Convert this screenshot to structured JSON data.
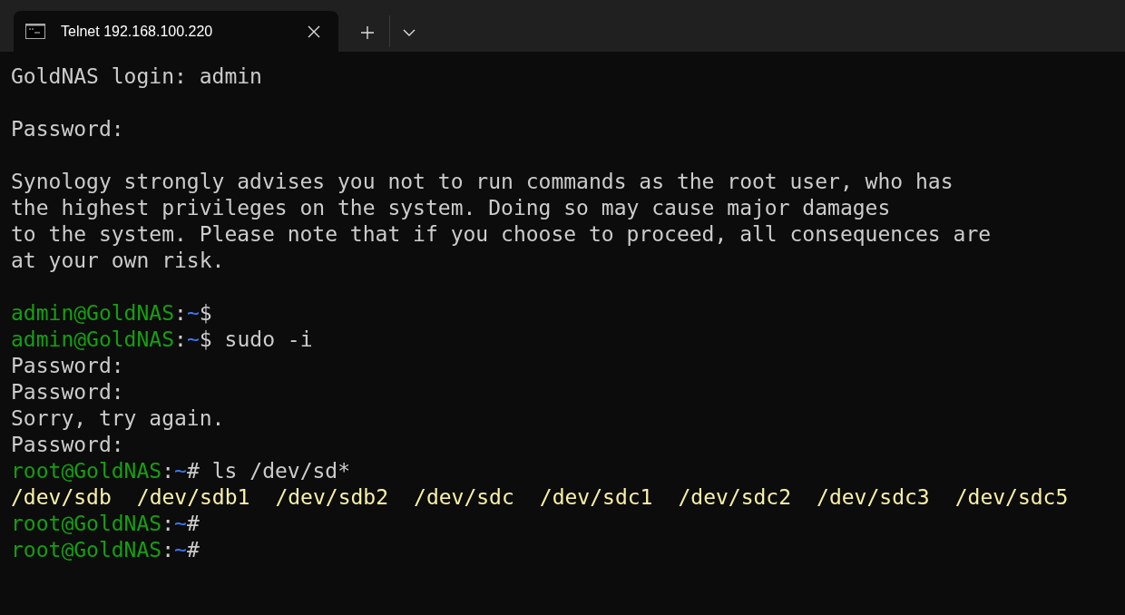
{
  "tabs": [
    {
      "title": "Telnet 192.168.100.220",
      "selected": true
    }
  ],
  "terminal": {
    "lines": [
      {
        "kind": "text",
        "text": "GoldNAS login: admin"
      },
      {
        "kind": "blank"
      },
      {
        "kind": "text",
        "text": "Password:"
      },
      {
        "kind": "blank"
      },
      {
        "kind": "text",
        "text": "Synology strongly advises you not to run commands as the root user, who has"
      },
      {
        "kind": "text",
        "text": "the highest privileges on the system. Doing so may cause major damages"
      },
      {
        "kind": "text",
        "text": "to the system. Please note that if you choose to proceed, all consequences are"
      },
      {
        "kind": "text",
        "text": "at your own risk."
      },
      {
        "kind": "blank"
      },
      {
        "kind": "prompt",
        "user_host": "admin@GoldNAS",
        "separator": ":",
        "path": "~",
        "symbol": "$"
      },
      {
        "kind": "prompt",
        "user_host": "admin@GoldNAS",
        "separator": ":",
        "path": "~",
        "symbol": "$",
        "command": "sudo -i"
      },
      {
        "kind": "text",
        "text": "Password:"
      },
      {
        "kind": "text",
        "text": "Password:"
      },
      {
        "kind": "text",
        "text": "Sorry, try again."
      },
      {
        "kind": "text",
        "text": "Password:"
      },
      {
        "kind": "prompt",
        "user_host": "root@GoldNAS",
        "separator": ":",
        "path": "~",
        "symbol": "#",
        "command": "ls /dev/sd*"
      },
      {
        "kind": "files",
        "items": [
          "/dev/sdb",
          "/dev/sdb1",
          "/dev/sdb2",
          "/dev/sdc",
          "/dev/sdc1",
          "/dev/sdc2",
          "/dev/sdc3",
          "/dev/sdc5"
        ]
      },
      {
        "kind": "prompt",
        "user_host": "root@GoldNAS",
        "separator": ":",
        "path": "~",
        "symbol": "#"
      },
      {
        "kind": "prompt",
        "user_host": "root@GoldNAS",
        "separator": ":",
        "path": "~",
        "symbol": "#"
      }
    ]
  }
}
